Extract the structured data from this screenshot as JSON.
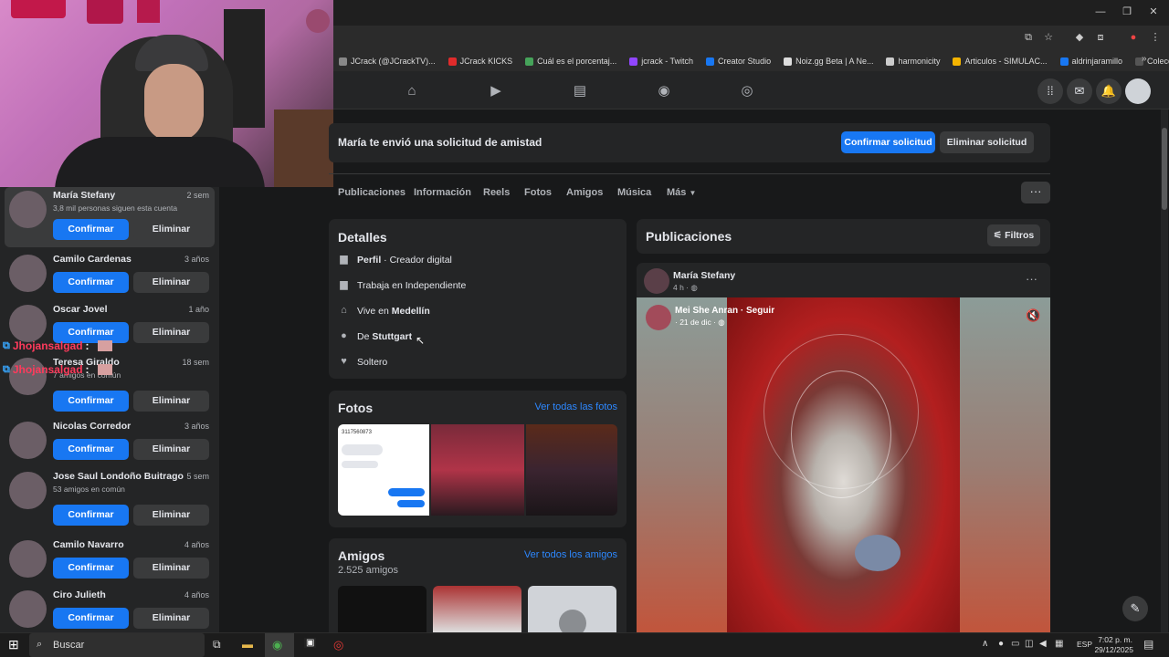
{
  "bookmarks": [
    {
      "label": "JCrack (@JCrackTV)...",
      "color": "#888888"
    },
    {
      "label": "JCrack KICKS",
      "color": "#e02b2b"
    },
    {
      "label": "Cuál es el porcentaj...",
      "color": "#46a35a"
    },
    {
      "label": "jcrack - Twitch",
      "color": "#9146ff"
    },
    {
      "label": "Creator Studio",
      "color": "#1877f2"
    },
    {
      "label": "Noiz.gg Beta | A Ne...",
      "color": "#dddddd"
    },
    {
      "label": "harmonicity",
      "color": "#cccccc"
    },
    {
      "label": "Articulos - SIMULAC...",
      "color": "#f4b400"
    },
    {
      "label": "aldrinjaramillo",
      "color": "#1877f2"
    },
    {
      "label": "Colección de M_blei...",
      "color": "#555555"
    }
  ],
  "friend_requests": [
    {
      "name": "María Stefany",
      "time": "2 sem",
      "sub": "3,8 mil personas siguen esta cuenta",
      "confirm": "Confirmar",
      "delete": "Eliminar"
    },
    {
      "name": "Camilo Cardenas",
      "time": "3 años",
      "sub": "",
      "confirm": "Confirmar",
      "delete": "Eliminar"
    },
    {
      "name": "Oscar Jovel",
      "time": "1 año",
      "sub": "",
      "confirm": "Confirmar",
      "delete": "Eliminar"
    },
    {
      "name": "Teresa Giraldo",
      "time": "18 sem",
      "sub": "7 amigos en común",
      "confirm": "Confirmar",
      "delete": "Eliminar"
    },
    {
      "name": "Nicolas Corredor",
      "time": "3 años",
      "sub": "",
      "confirm": "Confirmar",
      "delete": "Eliminar"
    },
    {
      "name": "Jose Saul Londoño Buitrago",
      "time": "5 sem",
      "sub": "53 amigos en común",
      "confirm": "Confirmar",
      "delete": "Eliminar"
    },
    {
      "name": "Camilo Navarro",
      "time": "4 años",
      "sub": "",
      "confirm": "Confirmar",
      "delete": "Eliminar"
    },
    {
      "name": "Ciro Julieth",
      "time": "4 años",
      "sub": "",
      "confirm": "Confirmar",
      "delete": "Eliminar"
    }
  ],
  "chat_overlay": {
    "user1": "Jhojansalgad",
    "user2": "Jhojansalgad",
    "sep": ":"
  },
  "request_bar": {
    "text": "María te envió una solicitud de amistad",
    "confirm": "Confirmar solicitud",
    "delete": "Eliminar solicitud"
  },
  "tabs": [
    "Publicaciones",
    "Información",
    "Reels",
    "Fotos",
    "Amigos",
    "Música",
    "Más"
  ],
  "details": {
    "title": "Detalles",
    "profile_label": "Perfil",
    "profile_value": " · Creador digital",
    "work": "Trabaja en Independiente",
    "lives_prefix": "Vive en ",
    "lives_city": "Medellín",
    "from_prefix": "De ",
    "from_city": "Stuttgart",
    "status": "Soltero"
  },
  "photos": {
    "title": "Fotos",
    "see_all": "Ver todas las fotos",
    "chat_number": "3117560873"
  },
  "friends": {
    "title": "Amigos",
    "count": "2.525 amigos",
    "see_all": "Ver todos los amigos"
  },
  "posts": {
    "title": "Publicaciones",
    "filters": "Filtros"
  },
  "post": {
    "author": "María Stefany",
    "time": "4 h ·",
    "shared_author": "Mei She Anran · Seguir",
    "shared_time": "· 21 de dic ·"
  },
  "taskbar": {
    "search": "Buscar",
    "lang": "ESP",
    "time": "7:02 p. m.",
    "date": "29/12/2025"
  }
}
